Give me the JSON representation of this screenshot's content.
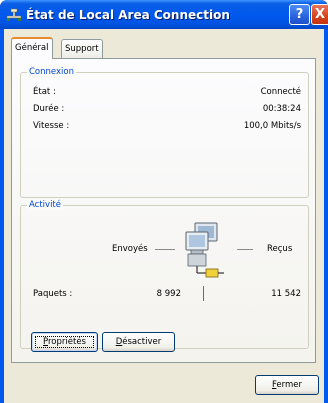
{
  "window": {
    "title": "État de Local Area Connection",
    "help_glyph": "?",
    "close_glyph": "X"
  },
  "tabs": [
    {
      "label": "Général"
    },
    {
      "label": "Support"
    }
  ],
  "connexion": {
    "legend": "Connexion",
    "rows": [
      {
        "label": "État :",
        "value": "Connecté"
      },
      {
        "label": "Durée :",
        "value": "00:38:24"
      },
      {
        "label": "Vitesse :",
        "value": "100,0 Mbits/s"
      }
    ]
  },
  "activite": {
    "legend": "Activité",
    "sent_label": "Envoyés",
    "received_label": "Reçus",
    "packets_label": "Paquets :",
    "packets_sent": "8 992",
    "packets_received": "11 542"
  },
  "buttons": {
    "properties_first": "P",
    "properties_rest": "ropriétés",
    "disable_first": "D",
    "disable_rest": "ésactiver",
    "close_first": "F",
    "close_rest": "ermer"
  },
  "icons": {
    "title": "network-connection-icon",
    "activity": "network-computers-icon"
  },
  "colors": {
    "titlebar": "#0054e3",
    "group_legend": "#0046d5",
    "dialog_bg": "#ece9d8"
  }
}
